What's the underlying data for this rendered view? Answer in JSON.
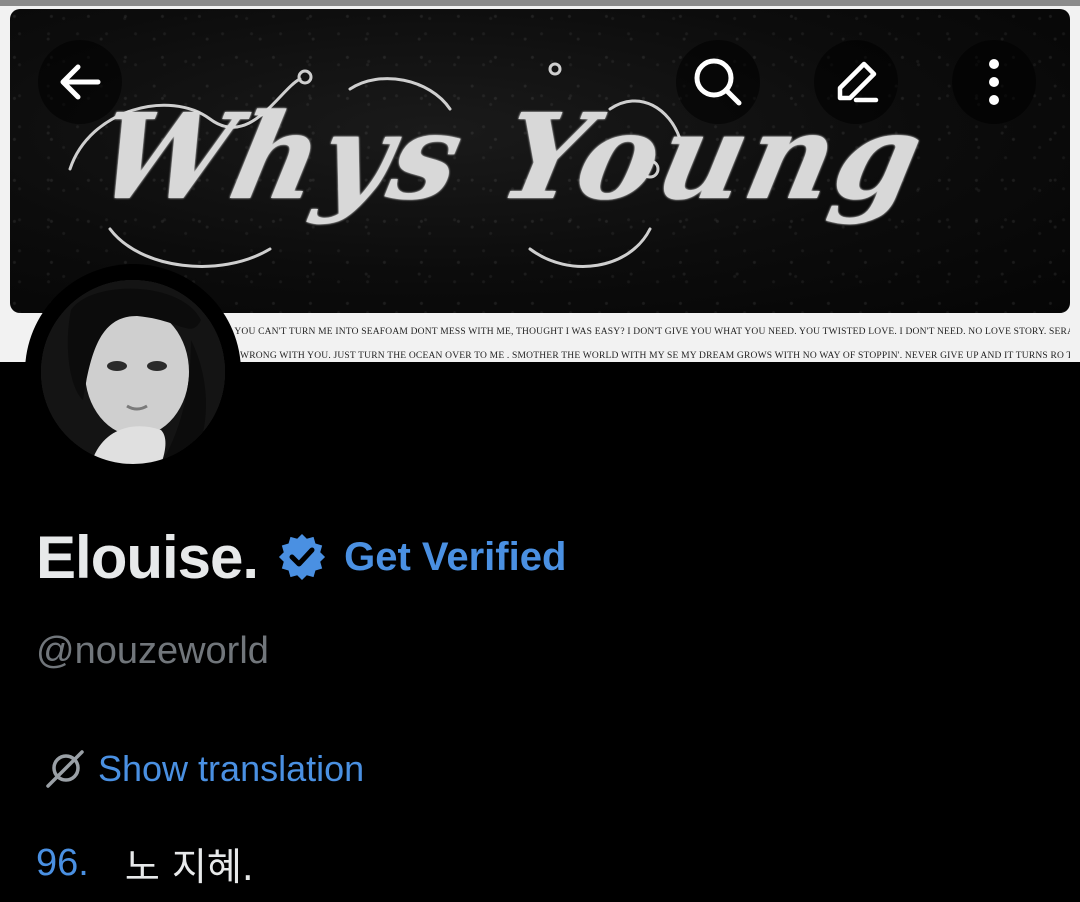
{
  "banner": {
    "logo_text": "Whys Young",
    "lyrics_lines": [
      "WANT. YOU CAN'T TURN ME INTO SEAFOAM DONT MESS WITH ME, THOUGHT I WAS EASY? I DON'T GIVE YOU WHAT YOU NEED. YOU TWISTED LOVE. I DON'T NEED. NO LOVE STORY. SERAPHIM",
      "WHAT'S WRONG WITH YOU. JUST TURN THE OCEAN OVER TO ME . SMOTHER THE WORLD WITH MY SE MY DREAM GROWS WITH NO WAY OF STOPPIN'. NEVER GIVE UP AND IT TURNS RO TRUTH."
    ]
  },
  "nav": {
    "back_icon": "arrow-left-icon",
    "search_icon": "search-icon",
    "edit_icon": "pencil-icon",
    "more_icon": "more-vertical-icon"
  },
  "profile": {
    "display_name": "Elouise.",
    "verified_icon": "verified-badge-icon",
    "get_verified_label": "Get Verified",
    "handle": "@nouzeworld",
    "translation_label": "Show translation",
    "bio_number": "96.",
    "bio_text": "노 지혜."
  },
  "colors": {
    "background": "#000000",
    "accent": "#4a90e2",
    "text_primary": "#e7e9ea",
    "text_secondary": "#71767b"
  }
}
